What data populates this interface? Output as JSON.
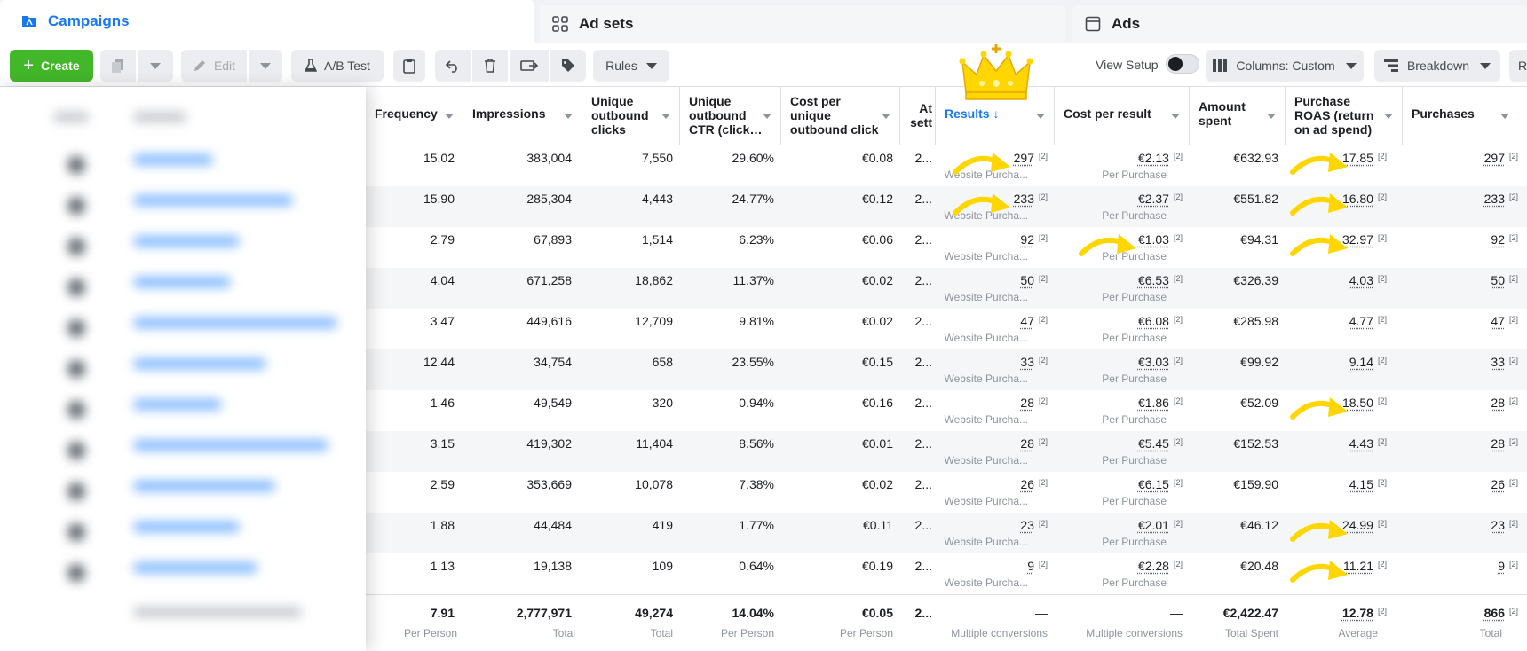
{
  "tabs": {
    "campaigns": "Campaigns",
    "ad_sets": "Ad sets",
    "ads": "Ads"
  },
  "toolbar": {
    "create": "Create",
    "edit": "Edit",
    "ab_test": "A/B Test",
    "rules": "Rules",
    "view_setup": "View Setup",
    "columns": "Columns: Custom",
    "breakdown": "Breakdown",
    "overflow": "R"
  },
  "headers": {
    "frequency": "Frequency",
    "impressions": "Impressions",
    "unique_outbound_clicks": "Unique outbound clicks",
    "unique_outbound_ctr": "Unique outbound CTR (click…",
    "cost_per_unique_outbound_click": "Cost per unique outbound click",
    "attribution": "At sett",
    "results": "Results ↓",
    "cost_per_result": "Cost per result",
    "amount_spent": "Amount spent",
    "purchase_roas": "Purchase ROAS (return on ad spend)",
    "purchases": "Purchases"
  },
  "row_labels": {
    "results_sub": "Website Purcha...",
    "cpr_sub": "Per Purchase",
    "attr_value": "2...",
    "footnote": "[2]"
  },
  "rows": [
    {
      "frequency": "15.02",
      "impressions": "383,004",
      "clicks": "7,550",
      "ctr": "29.60%",
      "cpc": "€0.08",
      "results": "297",
      "cpr": "€2.13",
      "spent": "€632.93",
      "roas": "17.85",
      "purchases": "297"
    },
    {
      "frequency": "15.90",
      "impressions": "285,304",
      "clicks": "4,443",
      "ctr": "24.77%",
      "cpc": "€0.12",
      "results": "233",
      "cpr": "€2.37",
      "spent": "€551.82",
      "roas": "16.80",
      "purchases": "233"
    },
    {
      "frequency": "2.79",
      "impressions": "67,893",
      "clicks": "1,514",
      "ctr": "6.23%",
      "cpc": "€0.06",
      "results": "92",
      "cpr": "€1.03",
      "spent": "€94.31",
      "roas": "32.97",
      "purchases": "92"
    },
    {
      "frequency": "4.04",
      "impressions": "671,258",
      "clicks": "18,862",
      "ctr": "11.37%",
      "cpc": "€0.02",
      "results": "50",
      "cpr": "€6.53",
      "spent": "€326.39",
      "roas": "4.03",
      "purchases": "50"
    },
    {
      "frequency": "3.47",
      "impressions": "449,616",
      "clicks": "12,709",
      "ctr": "9.81%",
      "cpc": "€0.02",
      "results": "47",
      "cpr": "€6.08",
      "spent": "€285.98",
      "roas": "4.77",
      "purchases": "47"
    },
    {
      "frequency": "12.44",
      "impressions": "34,754",
      "clicks": "658",
      "ctr": "23.55%",
      "cpc": "€0.15",
      "results": "33",
      "cpr": "€3.03",
      "spent": "€99.92",
      "roas": "9.14",
      "purchases": "33"
    },
    {
      "frequency": "1.46",
      "impressions": "49,549",
      "clicks": "320",
      "ctr": "0.94%",
      "cpc": "€0.16",
      "results": "28",
      "cpr": "€1.86",
      "spent": "€52.09",
      "roas": "18.50",
      "purchases": "28"
    },
    {
      "frequency": "3.15",
      "impressions": "419,302",
      "clicks": "11,404",
      "ctr": "8.56%",
      "cpc": "€0.01",
      "results": "28",
      "cpr": "€5.45",
      "spent": "€152.53",
      "roas": "4.43",
      "purchases": "28"
    },
    {
      "frequency": "2.59",
      "impressions": "353,669",
      "clicks": "10,078",
      "ctr": "7.38%",
      "cpc": "€0.02",
      "results": "26",
      "cpr": "€6.15",
      "spent": "€159.90",
      "roas": "4.15",
      "purchases": "26"
    },
    {
      "frequency": "1.88",
      "impressions": "44,484",
      "clicks": "419",
      "ctr": "1.77%",
      "cpc": "€0.11",
      "results": "23",
      "cpr": "€2.01",
      "spent": "€46.12",
      "roas": "24.99",
      "purchases": "23"
    },
    {
      "frequency": "1.13",
      "impressions": "19,138",
      "clicks": "109",
      "ctr": "0.64%",
      "cpc": "€0.19",
      "results": "9",
      "cpr": "€2.28",
      "spent": "€20.48",
      "roas": "11.21",
      "purchases": "9"
    }
  ],
  "totals": {
    "frequency": "7.91",
    "frequency_sub": "Per Person",
    "impressions": "2,777,971",
    "impressions_sub": "Total",
    "clicks": "49,274",
    "clicks_sub": "Total",
    "ctr": "14.04%",
    "ctr_sub": "Per Person",
    "cpc": "€0.05",
    "cpc_sub": "Per Person",
    "attr": "2...",
    "results": "—",
    "results_sub": "Multiple conversions",
    "cpr": "—",
    "cpr_sub": "Multiple conversions",
    "spent": "€2,422.47",
    "spent_sub": "Total Spent",
    "roas": "12.78",
    "roas_sub": "Average",
    "purchases": "866",
    "purchases_sub": "Total"
  },
  "highlight_arrows": {
    "results_rows": [
      0,
      1
    ],
    "cpr_rows": [
      2
    ],
    "roas_rows": [
      0,
      1,
      2,
      6,
      9,
      10
    ]
  },
  "colors": {
    "accent_blue": "#1877f2",
    "create_green": "#42b72a",
    "annotation_yellow": "#ffd600"
  }
}
